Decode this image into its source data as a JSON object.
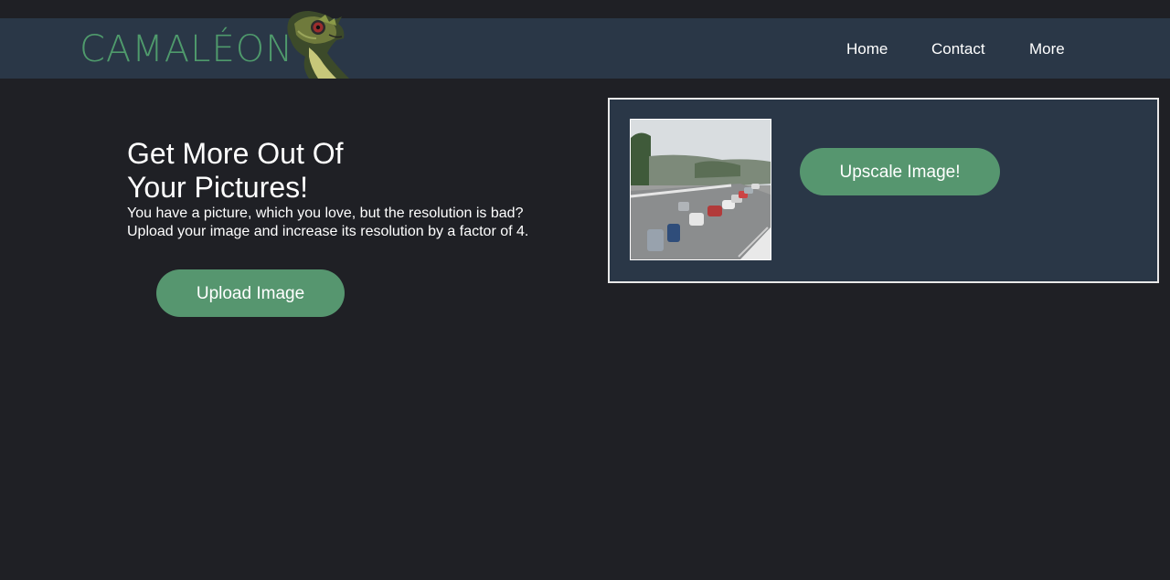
{
  "header": {
    "logo_text": "CAMALÉON",
    "nav": {
      "home": "Home",
      "contact": "Contact",
      "more": "More"
    }
  },
  "hero": {
    "headline_line1": "Get More Out Of",
    "headline_line2": "Your Pictures!",
    "description_line1": "You have a picture, which you love, but the resolution is bad?",
    "description_line2": "Upload your image and increase its resolution by a factor of 4.",
    "upload_button": "Upload Image"
  },
  "preview": {
    "upscale_button": "Upscale Image!"
  },
  "colors": {
    "background": "#1f2025",
    "topbar": "#2a3747",
    "accent_green": "#56966f",
    "logo_green": "#4f9a6c"
  }
}
